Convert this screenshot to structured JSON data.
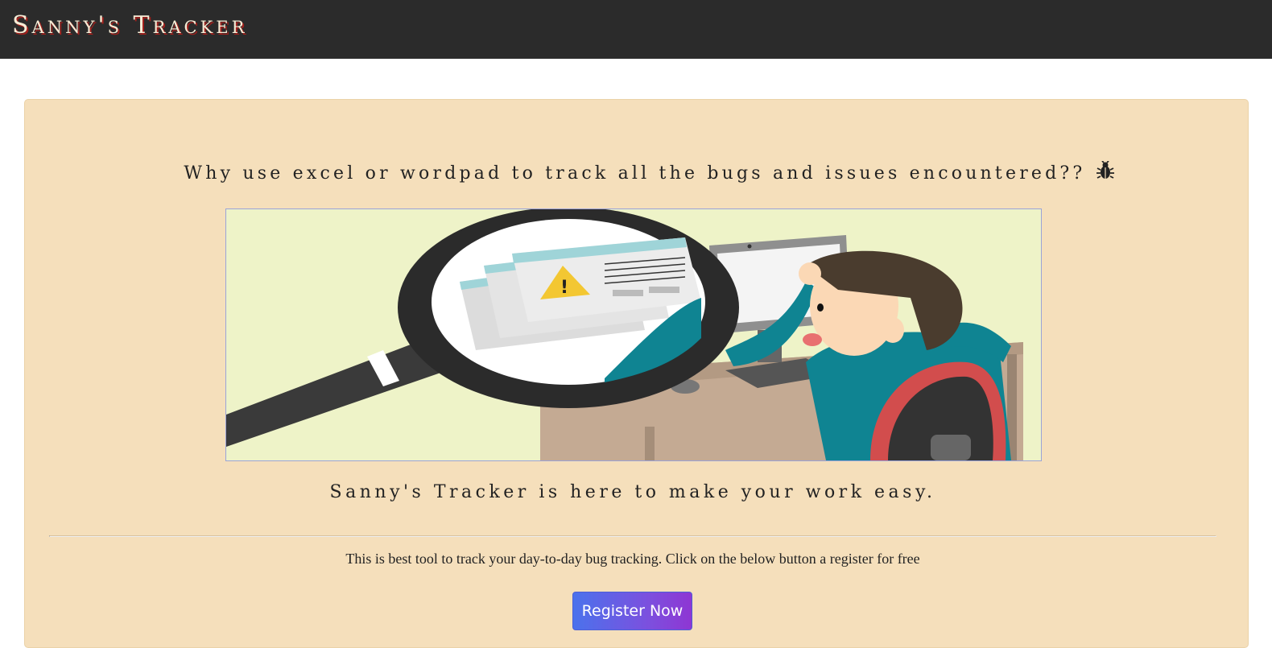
{
  "navbar": {
    "brand": "Sanny's Tracker"
  },
  "hero": {
    "headline": "Why use excel or wordpad to track all the bugs and issues encountered??",
    "headline_icon": "bug-icon",
    "image": "illustration: frustrated developer at computer with magnifying glass over warning windows",
    "tagline": "Sanny's Tracker is here to make your work easy.",
    "description": "This is best tool to track your day-to-day bug tracking. Click on the below button a register for free",
    "register_label": "Register Now"
  },
  "colors": {
    "navbar_bg": "#2b2b2b",
    "brand_text": "#f6ecd6",
    "brand_shadow": "#a3201c",
    "jumbotron_bg": "#f5dfbb",
    "button_gradient_start": "#4b72ec",
    "button_gradient_end": "#8e36d3"
  }
}
